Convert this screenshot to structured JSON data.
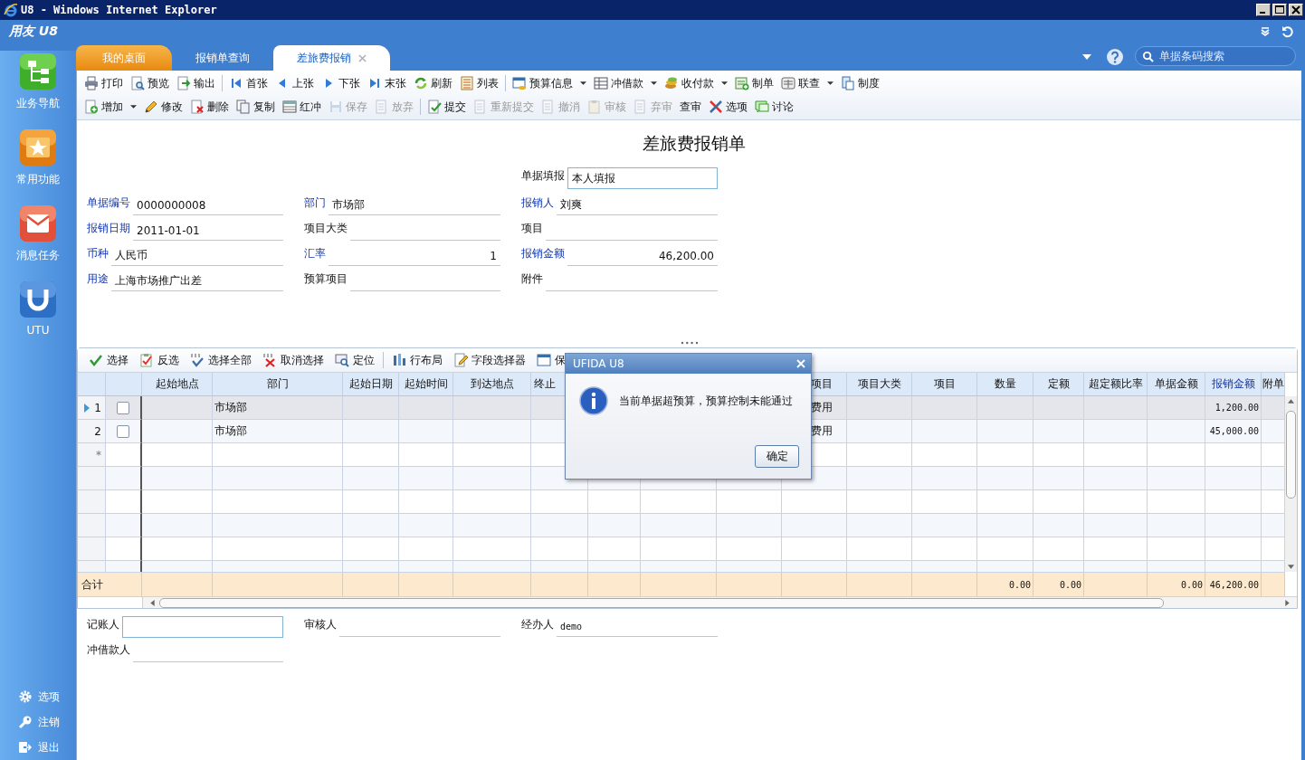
{
  "window": {
    "title": "U8 - Windows Internet Explorer"
  },
  "app": {
    "logo": "用友 U8"
  },
  "sidebar": {
    "items": [
      {
        "label": "业务导航"
      },
      {
        "label": "常用功能"
      },
      {
        "label": "消息任务"
      },
      {
        "label": "UTU"
      }
    ],
    "bottom_items": [
      {
        "label": "选项"
      },
      {
        "label": "注销"
      },
      {
        "label": "退出"
      }
    ]
  },
  "tabs": [
    {
      "label": "我的桌面",
      "kind": "home",
      "selected": false,
      "closable": false
    },
    {
      "label": "报销单查询",
      "kind": "page",
      "selected": false,
      "closable": false
    },
    {
      "label": "差旅费报销",
      "kind": "page",
      "selected": true,
      "closable": true
    }
  ],
  "search": {
    "placeholder": "单据条码搜索"
  },
  "main_toolbar": {
    "rows": [
      {
        "groups": [
          {
            "items": [
              {
                "label": "打印",
                "disabled": false,
                "dropdown": false
              },
              {
                "label": "预览",
                "disabled": false,
                "dropdown": false
              },
              {
                "label": "输出",
                "disabled": false,
                "dropdown": false
              }
            ]
          },
          {
            "items": [
              {
                "label": "首张",
                "disabled": false,
                "dropdown": false
              },
              {
                "label": "上张",
                "disabled": false,
                "dropdown": false
              },
              {
                "label": "下张",
                "disabled": false,
                "dropdown": false
              },
              {
                "label": "末张",
                "disabled": false,
                "dropdown": false
              },
              {
                "label": "刷新",
                "disabled": false,
                "dropdown": false
              },
              {
                "label": "列表",
                "disabled": false,
                "dropdown": false
              }
            ]
          },
          {
            "items": [
              {
                "label": "预算信息",
                "disabled": false,
                "dropdown": true
              },
              {
                "label": "冲借款",
                "disabled": false,
                "dropdown": true
              },
              {
                "label": "收付款",
                "disabled": false,
                "dropdown": true
              },
              {
                "label": "制单",
                "disabled": false,
                "dropdown": false
              },
              {
                "label": "联查",
                "disabled": false,
                "dropdown": true
              },
              {
                "label": "制度",
                "disabled": false,
                "dropdown": false
              }
            ]
          }
        ]
      },
      {
        "groups": [
          {
            "items": [
              {
                "label": "增加",
                "disabled": false,
                "dropdown": true
              },
              {
                "label": "修改",
                "disabled": false,
                "dropdown": false
              },
              {
                "label": "删除",
                "disabled": false,
                "dropdown": false
              },
              {
                "label": "复制",
                "disabled": false,
                "dropdown": false
              },
              {
                "label": "红冲",
                "disabled": false,
                "dropdown": false
              },
              {
                "label": "保存",
                "disabled": true,
                "dropdown": false
              },
              {
                "label": "放弃",
                "disabled": true,
                "dropdown": false
              }
            ]
          },
          {
            "items": [
              {
                "label": "提交",
                "disabled": false,
                "dropdown": false
              },
              {
                "label": "重新提交",
                "disabled": true,
                "dropdown": false
              },
              {
                "label": "撤消",
                "disabled": true,
                "dropdown": false
              },
              {
                "label": "审核",
                "disabled": true,
                "dropdown": false
              },
              {
                "label": "弃审",
                "disabled": true,
                "dropdown": false
              },
              {
                "label": "查审",
                "disabled": false,
                "dropdown": false
              },
              {
                "label": "选项",
                "disabled": false,
                "dropdown": false
              },
              {
                "label": "讨论",
                "disabled": false,
                "dropdown": false
              }
            ]
          }
        ]
      }
    ]
  },
  "form": {
    "title": "差旅费报销单",
    "header_field": {
      "label": "单据填报",
      "value": "本人填报",
      "kind": "input",
      "highlighted": false
    },
    "fields": [
      {
        "label": "单据编号",
        "value": "0000000008",
        "kind": "text",
        "highlighted": true
      },
      {
        "label": "部门",
        "value": "市场部",
        "kind": "text",
        "highlighted": true
      },
      {
        "label": "报销人",
        "value": "刘爽",
        "kind": "text",
        "highlighted": true
      },
      {
        "label": "报销日期",
        "value": "2011-01-01",
        "kind": "text",
        "highlighted": true
      },
      {
        "label": "项目大类",
        "kind": "text",
        "highlighted": false
      },
      {
        "label": "项目",
        "kind": "text",
        "highlighted": false
      },
      {
        "label": "币种",
        "value": "人民币",
        "kind": "text",
        "highlighted": true
      },
      {
        "label": "汇率",
        "value": "1",
        "kind": "number",
        "highlighted": true
      },
      {
        "label": "报销金额",
        "value": "46,200.00",
        "kind": "number",
        "highlighted": true
      },
      {
        "label": "用途",
        "value": "上海市场推广出差",
        "kind": "text",
        "highlighted": true
      },
      {
        "label": "预算项目",
        "kind": "text",
        "highlighted": false
      },
      {
        "label": "附件",
        "kind": "text",
        "highlighted": false
      }
    ]
  },
  "grid_toolbar": {
    "groups": [
      {
        "items": [
          {
            "label": "选择"
          },
          {
            "label": "反选"
          },
          {
            "label": "选择全部"
          },
          {
            "label": "取消选择"
          },
          {
            "label": "定位"
          }
        ]
      },
      {
        "items": [
          {
            "label": "行布局"
          },
          {
            "label": "字段选择器"
          },
          {
            "label": "保"
          }
        ]
      }
    ]
  },
  "table": {
    "columns": [
      {
        "header": "起始地点",
        "highlighted": false
      },
      {
        "header": "部门",
        "highlighted": false
      },
      {
        "header": "起始日期",
        "highlighted": false
      },
      {
        "header": "起始时间",
        "highlighted": false
      },
      {
        "header": "到达地点",
        "highlighted": false
      },
      {
        "header": "终止",
        "highlighted": false
      },
      {},
      {},
      {},
      {
        "header": "项目",
        "highlighted": false
      },
      {
        "header": "项目大类",
        "highlighted": false
      },
      {
        "header": "项目",
        "highlighted": false
      },
      {
        "header": "数量",
        "highlighted": false
      },
      {
        "header": "定额",
        "highlighted": false
      },
      {
        "header": "超定额比率",
        "highlighted": false
      },
      {
        "header": "单据金额",
        "highlighted": false
      },
      {
        "header": "报销金额",
        "highlighted": true
      },
      {
        "header": "附单",
        "highlighted": false
      }
    ],
    "rows": [
      {
        "number": "1",
        "selected": true,
        "checked": false,
        "department": "市场部",
        "cost_item": "费用",
        "claim_amount": "1,200.00"
      },
      {
        "number": "2",
        "selected": false,
        "checked": false,
        "department": "市场部",
        "cost_item": "费用",
        "claim_amount": "45,000.00"
      }
    ],
    "new_row_marker": "*",
    "totals": {
      "label": "合计",
      "quantity": "0.00",
      "quota": "0.00",
      "document_amount": "0.00",
      "claim_amount": "46,200.00"
    }
  },
  "footer_fields": [
    {
      "label": "记账人",
      "kind": "input"
    },
    {
      "label": "审核人",
      "kind": "text"
    },
    {
      "label": "经办人",
      "value": "demo",
      "kind": "text"
    },
    {
      "label": "冲借款人",
      "kind": "text"
    }
  ],
  "dialog": {
    "title": "UFIDA U8",
    "message": "当前单据超预算，预算控制未能通过",
    "button": "确定"
  }
}
